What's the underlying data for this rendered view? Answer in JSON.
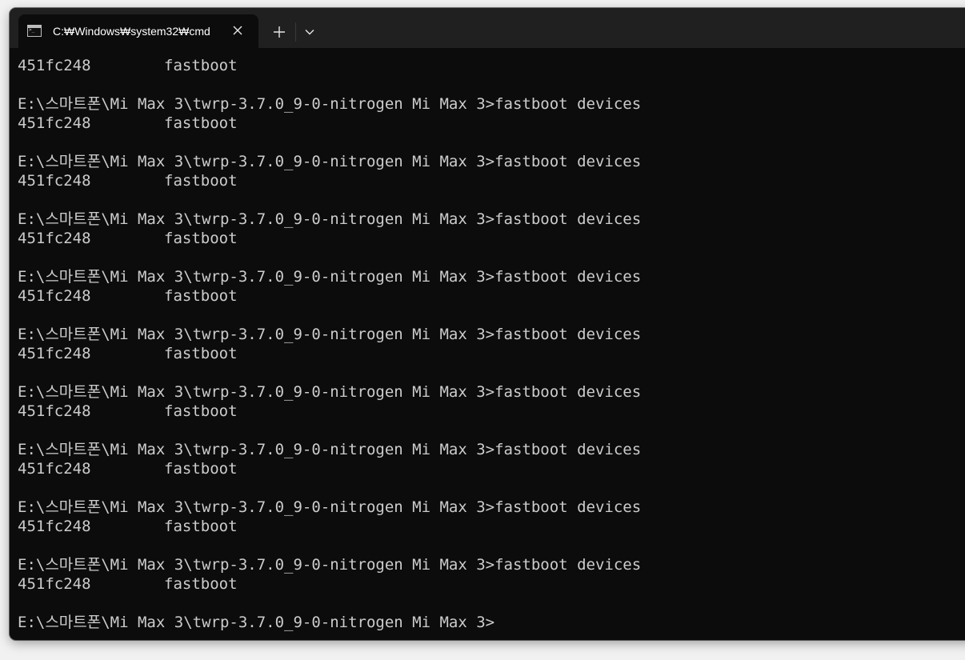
{
  "window": {
    "tab_title": "C:₩Windows₩system32₩cmd",
    "tab_icon": "console-icon",
    "close_icon": "close-icon",
    "new_tab_icon": "plus-icon",
    "dropdown_icon": "chevron-down-icon"
  },
  "console": {
    "lines": [
      "451fc248        fastboot",
      "",
      "E:\\스마트폰\\Mi Max 3\\twrp-3.7.0_9-0-nitrogen Mi Max 3>fastboot devices",
      "451fc248        fastboot",
      "",
      "E:\\스마트폰\\Mi Max 3\\twrp-3.7.0_9-0-nitrogen Mi Max 3>fastboot devices",
      "451fc248        fastboot",
      "",
      "E:\\스마트폰\\Mi Max 3\\twrp-3.7.0_9-0-nitrogen Mi Max 3>fastboot devices",
      "451fc248        fastboot",
      "",
      "E:\\스마트폰\\Mi Max 3\\twrp-3.7.0_9-0-nitrogen Mi Max 3>fastboot devices",
      "451fc248        fastboot",
      "",
      "E:\\스마트폰\\Mi Max 3\\twrp-3.7.0_9-0-nitrogen Mi Max 3>fastboot devices",
      "451fc248        fastboot",
      "",
      "E:\\스마트폰\\Mi Max 3\\twrp-3.7.0_9-0-nitrogen Mi Max 3>fastboot devices",
      "451fc248        fastboot",
      "",
      "E:\\스마트폰\\Mi Max 3\\twrp-3.7.0_9-0-nitrogen Mi Max 3>fastboot devices",
      "451fc248        fastboot",
      "",
      "E:\\스마트폰\\Mi Max 3\\twrp-3.7.0_9-0-nitrogen Mi Max 3>fastboot devices",
      "451fc248        fastboot",
      "",
      "E:\\스마트폰\\Mi Max 3\\twrp-3.7.0_9-0-nitrogen Mi Max 3>fastboot devices",
      "451fc248        fastboot",
      "",
      "E:\\스마트폰\\Mi Max 3\\twrp-3.7.0_9-0-nitrogen Mi Max 3>"
    ]
  },
  "colors": {
    "background": "#0c0c0c",
    "titlebar": "#202020",
    "text": "#cccccc"
  }
}
